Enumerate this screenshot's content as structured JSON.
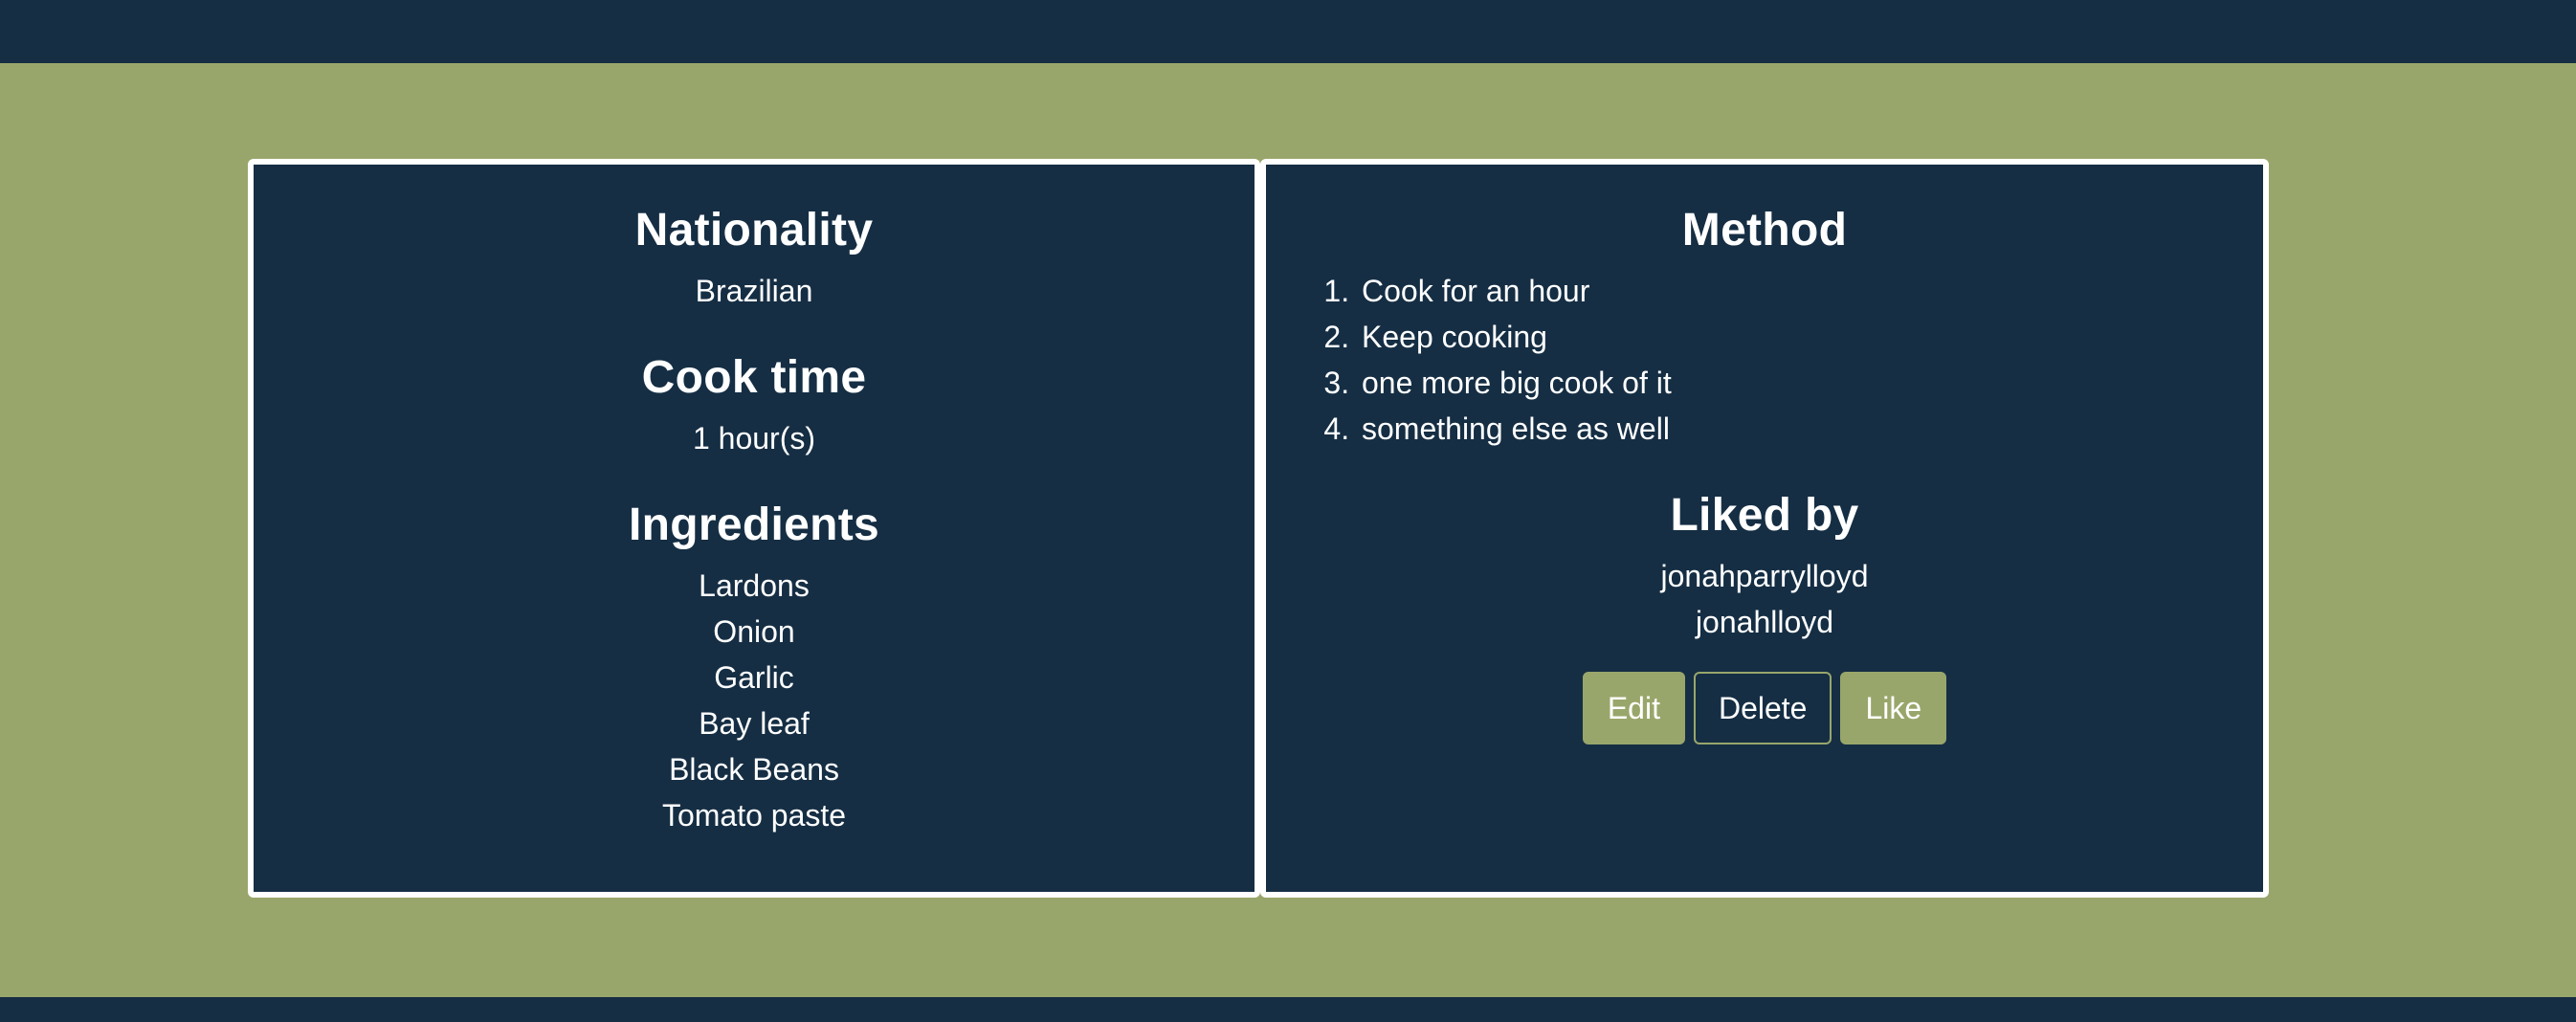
{
  "left_card": {
    "nationality": {
      "heading": "Nationality",
      "value": "Brazilian"
    },
    "cook_time": {
      "heading": "Cook time",
      "value": "1 hour(s)"
    },
    "ingredients": {
      "heading": "Ingredients",
      "items": [
        "Lardons",
        "Onion",
        "Garlic",
        "Bay leaf",
        "Black Beans",
        "Tomato paste"
      ]
    }
  },
  "right_card": {
    "method": {
      "heading": "Method",
      "steps": [
        "Cook for an hour",
        "Keep cooking",
        "one more big cook of it",
        "something else as well"
      ]
    },
    "liked_by": {
      "heading": "Liked by",
      "users": [
        "jonahparrylloyd",
        "jonahlloyd"
      ]
    },
    "buttons": {
      "edit": "Edit",
      "delete": "Delete",
      "like": "Like"
    }
  },
  "colors": {
    "navy": "#152e44",
    "olive": "#99a66b",
    "white": "#ffffff"
  }
}
